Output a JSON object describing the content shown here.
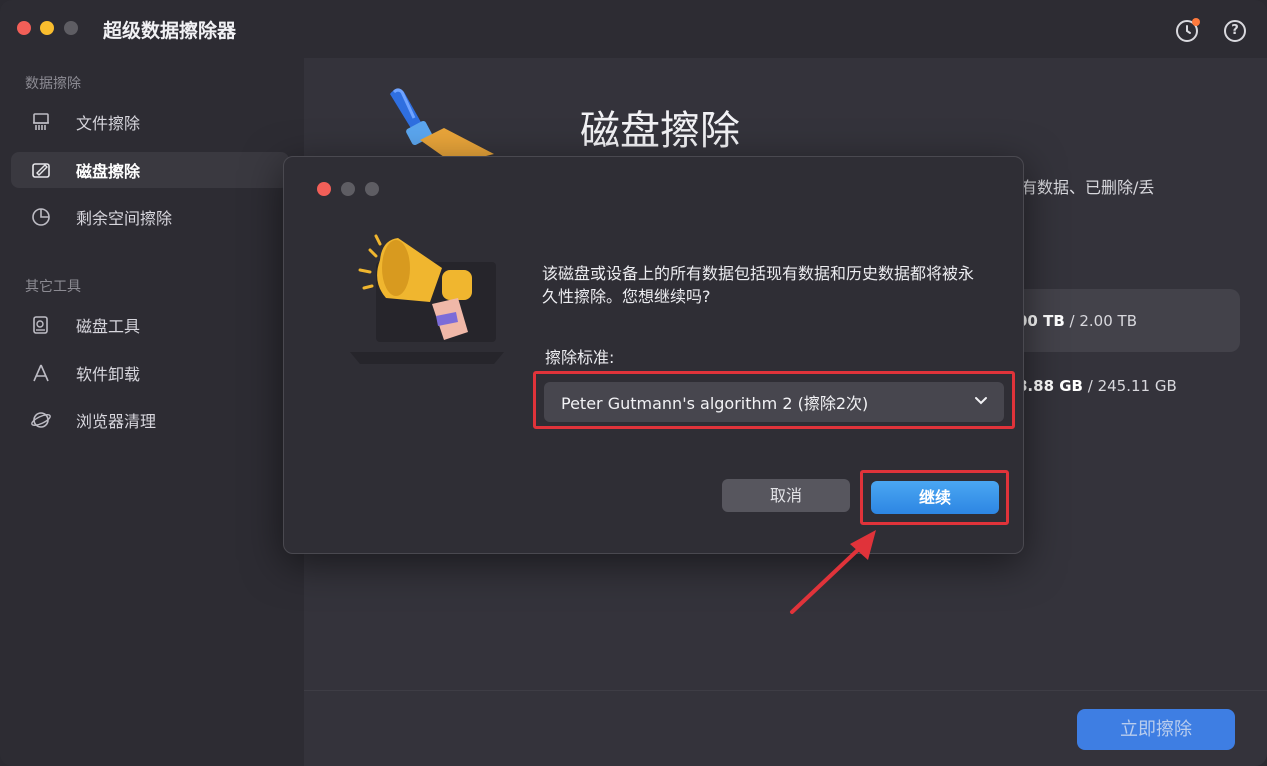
{
  "app": {
    "title": "超级数据擦除器"
  },
  "toolbar": {
    "history_icon": "history-icon",
    "help_icon": "help-icon"
  },
  "sidebar": {
    "sections": [
      {
        "label": "数据擦除",
        "items": [
          {
            "label": "文件擦除",
            "icon": "shredder-icon"
          },
          {
            "label": "磁盘擦除",
            "icon": "disk-edit-icon",
            "active": true
          },
          {
            "label": "剩余空间擦除",
            "icon": "pie-chart-icon"
          }
        ]
      },
      {
        "label": "其它工具",
        "items": [
          {
            "label": "磁盘工具",
            "icon": "disk-tool-icon"
          },
          {
            "label": "软件卸载",
            "icon": "app-uninstall-icon"
          },
          {
            "label": "浏览器清理",
            "icon": "browser-icon"
          }
        ]
      }
    ]
  },
  "main": {
    "title": "磁盘擦除",
    "description_fragment": "有数据、已删除/丢",
    "disks": [
      {
        "used": "00 TB",
        "total": "2.00 TB"
      },
      {
        "used": "8.88 GB",
        "total": "245.11 GB"
      }
    ],
    "erase_now_label": "立即擦除"
  },
  "dialog": {
    "message": "该磁盘或设备上的所有数据包括现有数据和历史数据都将被永久性擦除。您想继续吗?",
    "standard_label": "擦除标准:",
    "standard_value": "Peter Gutmann's algorithm 2 (擦除2次)",
    "cancel_label": "取消",
    "continue_label": "继续"
  },
  "colors": {
    "accent": "#3e7ee3",
    "highlight_border": "#e0333a",
    "continue_button": "#3a96ea"
  }
}
